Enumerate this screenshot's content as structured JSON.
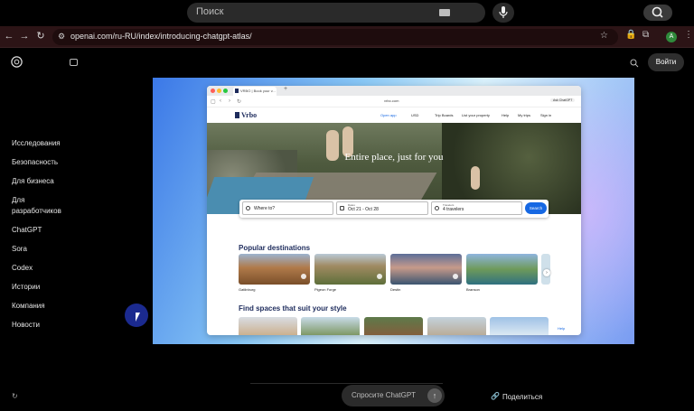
{
  "top_search": {
    "placeholder": "Поиск"
  },
  "browser": {
    "url": "openai.com/ru-RU/index/introducing-chatgpt-atlas/",
    "profile_initial": "A"
  },
  "header": {
    "login_label": "Войти"
  },
  "nav": {
    "items": [
      "Исследования",
      "Безопасность",
      "Для бизнеса",
      "Для разработчиков",
      "ChatGPT",
      "Sora",
      "Codex",
      "Истории",
      "Компания",
      "Новости"
    ]
  },
  "demo": {
    "tab_title": "VRBO | Book your v...",
    "address": "vrbo.com",
    "ask_chatgpt": "Ask ChatGPT",
    "logo": "Vrbo",
    "menu": [
      "Open app",
      "USD",
      "Trip Boards",
      "List your property",
      "Help",
      "My trips",
      "Sign in"
    ],
    "hero_title": "Entire place, just for you",
    "search": {
      "where_placeholder": "Where to?",
      "dates_label": "Dates",
      "dates_value": "Oct 21 - Oct 28",
      "travelers_label": "Travelers",
      "travelers_value": "4 travelers",
      "button": "Search"
    },
    "section_popular": "Popular destinations",
    "destinations": [
      "Gatlinburg",
      "Pigeon Forge",
      "Destin",
      "Branson"
    ],
    "section_spaces": "Find spaces that suit your style",
    "help": "Help"
  },
  "bottom": {
    "ask_placeholder": "Спросите ChatGPT",
    "share_label": "Поделиться"
  }
}
